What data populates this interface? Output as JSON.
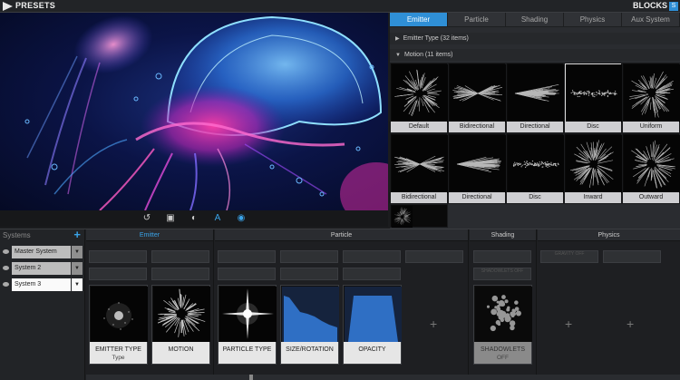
{
  "topbar": {
    "title": "PRESETS",
    "right_label": "BLOCKS",
    "logo_icon": "play-logo-icon",
    "right_icon": "close-icon"
  },
  "preview": {
    "description_icon": "jellyfish-render"
  },
  "preview_toolbar": {
    "buttons": [
      {
        "name": "reset-icon",
        "glyph": "↺"
      },
      {
        "name": "camera-icon",
        "glyph": "▣"
      },
      {
        "name": "motion-blur-icon",
        "glyph": "◐"
      },
      {
        "name": "text-icon",
        "glyph": "A"
      },
      {
        "name": "eye-icon",
        "glyph": "◉"
      }
    ]
  },
  "tabs": [
    "Emitter",
    "Particle",
    "Shading",
    "Physics",
    "Aux System"
  ],
  "active_tab": "Emitter",
  "groups": {
    "emitter_type": "Emitter Type  (32 items)",
    "motion": "Motion  (11 items)"
  },
  "motion_items": [
    {
      "label": "Default",
      "style": "burst"
    },
    {
      "label": "Bidirectional",
      "style": "bow"
    },
    {
      "label": "Directional",
      "style": "cone"
    },
    {
      "label": "Disc",
      "style": "disc",
      "selected": true
    },
    {
      "label": "Uniform",
      "style": "burst"
    },
    {
      "label": "Bidirectional",
      "style": "bow"
    },
    {
      "label": "Directional",
      "style": "cone"
    },
    {
      "label": "Disc",
      "style": "disc"
    },
    {
      "label": "Inward",
      "style": "burst"
    },
    {
      "label": "Outward",
      "style": "burst"
    }
  ],
  "systems": {
    "header": "Systems",
    "add_icon": "plus-icon",
    "items": [
      {
        "label": "Master System",
        "style": "gray"
      },
      {
        "label": "System 2",
        "style": "gray"
      },
      {
        "label": "System 3",
        "style": "white"
      }
    ]
  },
  "sections": {
    "emitter": "Emitter",
    "particle": "Particle",
    "shading": "Shading",
    "physics": "Physics"
  },
  "cards": {
    "emitter_type": {
      "label": "EMITTER TYPE",
      "sub": "Type"
    },
    "motion": {
      "label": "MOTION"
    },
    "particle_type": {
      "label": "PARTICLE TYPE"
    },
    "size_rotation": {
      "label": "SIZE/ROTATION"
    },
    "opacity": {
      "label": "OPACITY"
    },
    "shadowlets": {
      "label": "SHADOWLETS",
      "sub": "OFF"
    }
  },
  "ghost_labels": {
    "shadowlets_off": "SHADOWLETS OFF",
    "gravity_off": "GRAVITY OFF"
  },
  "colors": {
    "accent": "#2f8fd6"
  }
}
